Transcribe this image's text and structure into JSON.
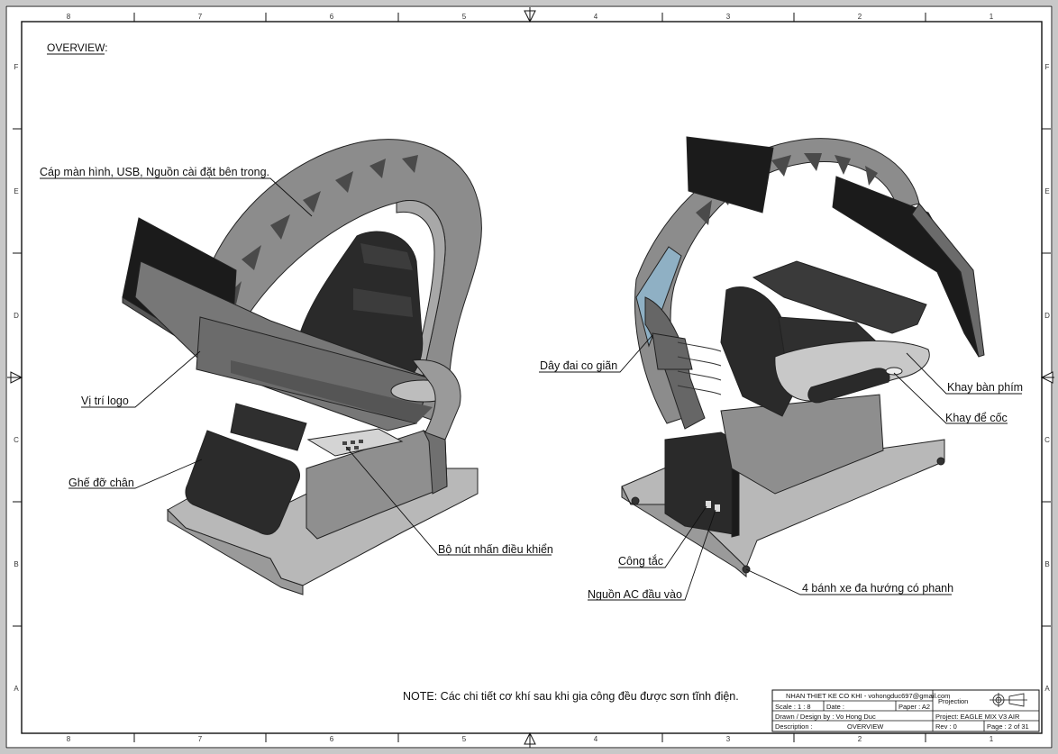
{
  "sheet": {
    "overview_label": "OVERVIEW:",
    "note": "NOTE: Các chi tiết cơ khí sau khi gia công đều được sơn tĩnh điện.",
    "zones": {
      "columns": [
        "8",
        "7",
        "6",
        "5",
        "4",
        "3",
        "2",
        "1"
      ],
      "rows": [
        "F",
        "E",
        "D",
        "C",
        "B",
        "A"
      ]
    }
  },
  "callouts": {
    "cables": "Cáp màn hình, USB, Nguồn cài đặt bên trong.",
    "logo": "Vị trí logo",
    "footrest": "Ghế đỡ chân",
    "control_buttons": "Bộ nút nhấn điều khiển",
    "elastic_strap": "Dây đai co giãn",
    "keyboard_tray": "Khay bàn phím",
    "cup_tray": "Khay để cốc",
    "switch": "Công tắc",
    "ac_input": "Nguồn AC đầu vào",
    "wheels": "4 bánh xe đa hướng có phanh"
  },
  "title_block": {
    "company": "NHAN THIET KE CO KHI - vohongduc697@gmail.com",
    "projection_label": "Projection",
    "scale": "Scale : 1 : 8",
    "date": "Date :",
    "paper": "Paper : A2",
    "drawn": "Drawn / Design by : Vo Hong Duc",
    "project": "Project: EAGLE MIX V3 AIR",
    "description_label": "Description :",
    "description": "OVERVIEW",
    "rev": "Rev : 0",
    "page": "Page : 2 of 31"
  },
  "colors": {
    "frame_gray": "#8e8e8e",
    "frame_light": "#b4b4b4",
    "seat_black": "#2a2a2a",
    "monitor_black": "#1b1b1b",
    "line": "#111111"
  }
}
